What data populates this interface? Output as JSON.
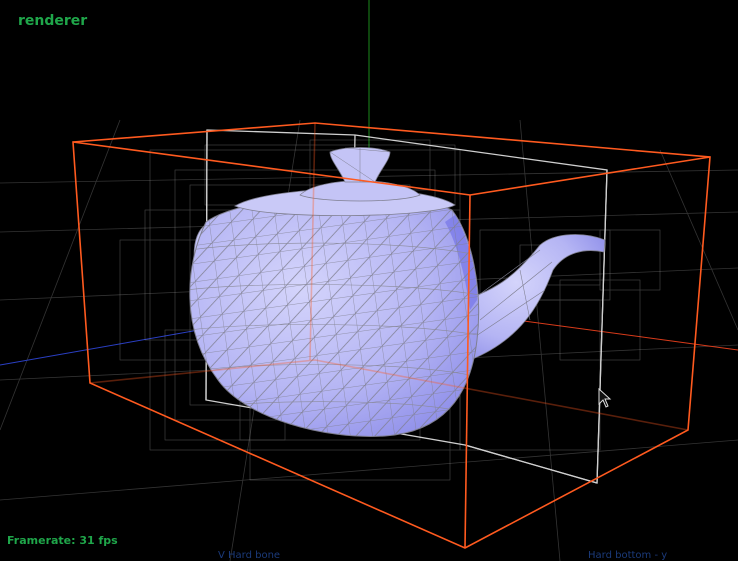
{
  "viewport": {
    "title": "renderer",
    "framerate_label": "Framerate: 31 fps",
    "bottom_left_label": "V   Hard bone",
    "bottom_right_label": "Hard bottom - y"
  },
  "colors": {
    "background": "#000000",
    "overlay_text": "#1fa64a",
    "bounding_box": "#ff5a1f",
    "inner_box": "#e6e6e6",
    "wireframe": "#9a9aa8",
    "teapot_fill": "#b7b7f5",
    "teapot_shadow": "#7c7ce8",
    "axis_y": "#1c8a1c",
    "axis_x": "#d93b1a",
    "axis_z": "#2a3fc4",
    "grid": "#4a4a4a"
  },
  "icons": [
    "mouse-cursor-icon"
  ]
}
